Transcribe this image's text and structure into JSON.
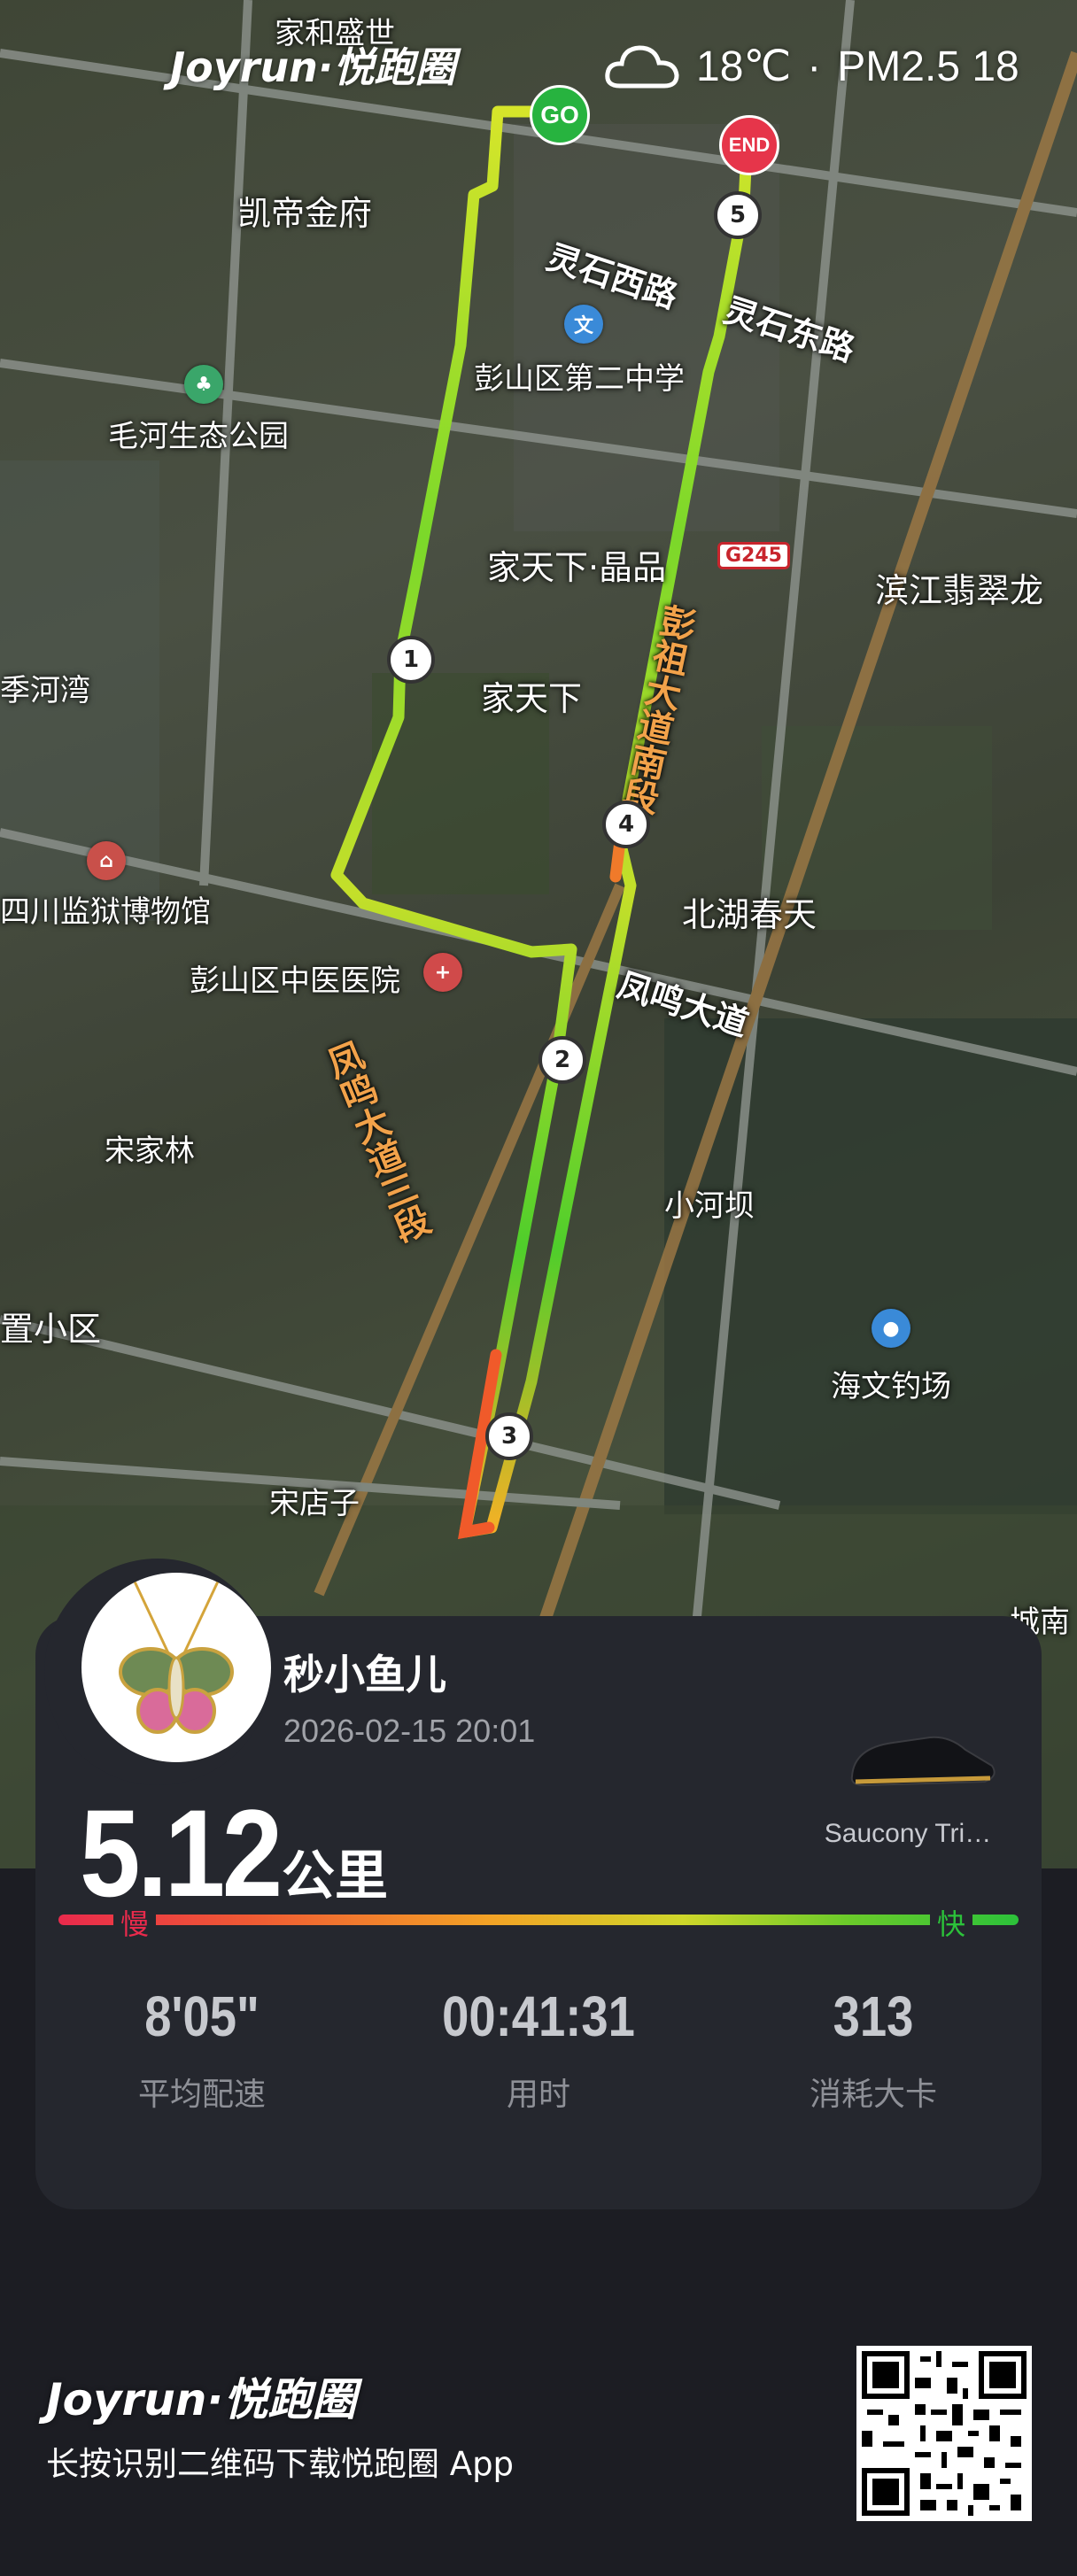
{
  "brand": {
    "logo": "Joyrun·悦跑圈"
  },
  "weather": {
    "icon": "cloud-icon",
    "temperature": "18℃",
    "separator": "·",
    "pm25": "PM2.5 18"
  },
  "map": {
    "labels": {
      "jiahe": "家和盛世",
      "kaidi": "凯帝金府",
      "maohe_park": "毛河生态公园",
      "school": "彭山区第二中学",
      "jiatianxia_jingpin": "家天下·晶品",
      "jiatianxia": "家天下",
      "binjiang": "滨江翡翠龙",
      "jihe_bay": "季河湾",
      "prison_museum": "四川监狱博物馆",
      "tcm_hospital": "彭山区中医医院",
      "beihu": "北湖春天",
      "songjialin": "宋家林",
      "xiaoheba": "小河坝",
      "haiwen": "海文钓场",
      "songdianzi": "宋店子",
      "xiaoqu": "置小区",
      "chengnan": "城南",
      "road_lingshi_w": "灵石西路",
      "road_lingshi_e": "灵石东路",
      "road_fengming": "凤鸣大道",
      "road_fengming_3": "凤鸣大道三段",
      "road_pengzu": "彭祖大道南段",
      "highway_shield": "G245"
    },
    "markers": {
      "start": "GO",
      "end": "END",
      "km": [
        "1",
        "2",
        "3",
        "4",
        "5"
      ]
    }
  },
  "card": {
    "username": "秒小鱼儿",
    "datetime": "2026-02-15 20:01",
    "distance": "5.12",
    "distance_unit": "公里",
    "shoe": "Saucony Tri…",
    "pace_slow": "慢",
    "pace_fast": "快",
    "stats": [
      {
        "value": "8'05\"",
        "label": "平均配速"
      },
      {
        "value": "00:41:31",
        "label": "用时"
      },
      {
        "value": "313",
        "label": "消耗大卡"
      }
    ]
  },
  "footer": {
    "brand": "Joyrun·悦跑圈",
    "text": "长按识别二维码下载悦跑圈 App"
  },
  "colors": {
    "slow": "#ea2a4c",
    "fast": "#2cc23a",
    "card": "#25272e",
    "background": "#1c1d23"
  }
}
